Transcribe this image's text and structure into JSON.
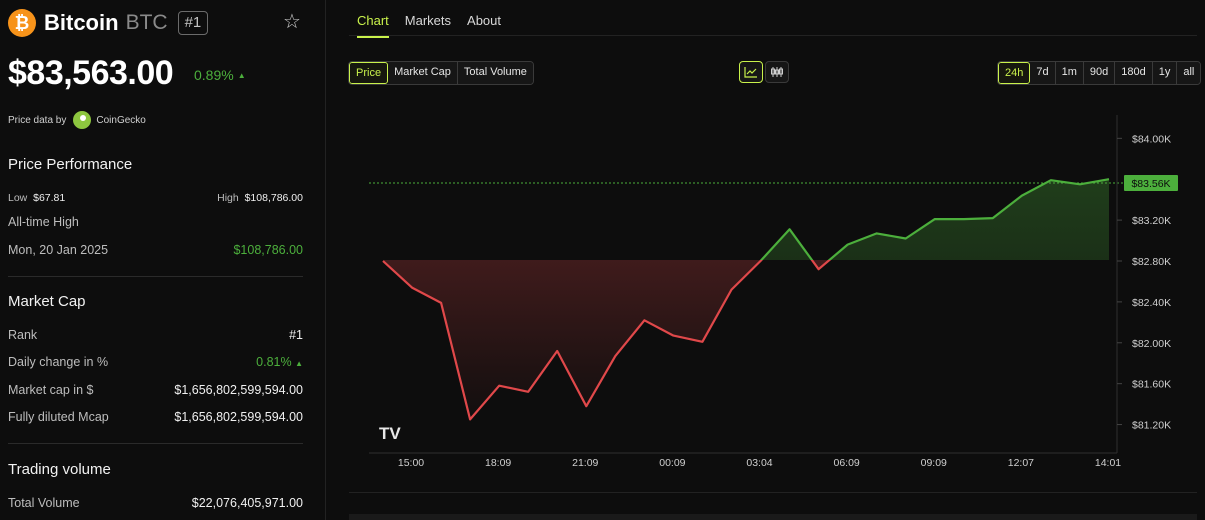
{
  "coin": {
    "logo_glyph": "₿",
    "name": "Bitcoin",
    "symbol": "BTC",
    "rank_badge": "#1",
    "star_icon": "☆"
  },
  "price": {
    "value": "$83,563.00",
    "change": "0.89%",
    "change_dir": "▲"
  },
  "source": {
    "label": "Price data by",
    "name": "CoinGecko"
  },
  "performance": {
    "title": "Price Performance",
    "low_label": "Low",
    "low_value": "$67.81",
    "high_label": "High",
    "high_value": "$108,786.00",
    "ath_label": "All-time High",
    "ath_date": "Mon, 20 Jan 2025",
    "ath_value": "$108,786.00"
  },
  "market_cap": {
    "title": "Market Cap",
    "rank_label": "Rank",
    "rank_value": "#1",
    "daily_label": "Daily change in %",
    "daily_value": "0.81%",
    "daily_dir": "▲",
    "mcap_label": "Market cap in $",
    "mcap_value": "$1,656,802,599,594.00",
    "fd_label": "Fully diluted Mcap",
    "fd_value": "$1,656,802,599,594.00"
  },
  "trading": {
    "title": "Trading volume",
    "total_label": "Total Volume",
    "total_value": "$22,076,405,971.00"
  },
  "tabs": [
    {
      "label": "Chart"
    },
    {
      "label": "Markets"
    },
    {
      "label": "About"
    }
  ],
  "metrics": [
    {
      "label": "Price"
    },
    {
      "label": "Market Cap"
    },
    {
      "label": "Total Volume"
    }
  ],
  "chart_types": [
    {
      "icon": "line-chart-icon",
      "glyph": "📈︎"
    },
    {
      "icon": "candlestick-icon",
      "glyph": "⫼"
    }
  ],
  "ranges": [
    {
      "label": "24h"
    },
    {
      "label": "7d"
    },
    {
      "label": "1m"
    },
    {
      "label": "90d"
    },
    {
      "label": "180d"
    },
    {
      "label": "1y"
    },
    {
      "label": "all"
    }
  ],
  "colors": {
    "accent": "#c9f24b",
    "up": "#4caf3c",
    "down": "#e0484a"
  },
  "chart_data": {
    "type": "line",
    "title": "",
    "xlabel": "",
    "ylabel": "",
    "x_ticks": [
      "15:00",
      "18:09",
      "21:09",
      "00:09",
      "03:04",
      "06:09",
      "09:09",
      "12:07",
      "14:01"
    ],
    "y_ticks": [
      "$84.00K",
      "$83.20K",
      "$82.80K",
      "$82.40K",
      "$82.00K",
      "$81.60K",
      "$81.20K"
    ],
    "ylim": [
      81000,
      84150
    ],
    "baseline": 82810,
    "current_label": "$83.56K",
    "current_value": 83563,
    "values": [
      82800,
      82540,
      82390,
      81250,
      81580,
      81520,
      81920,
      81380,
      81870,
      82220,
      82070,
      82010,
      82520,
      82800,
      83110,
      82720,
      82960,
      83070,
      83020,
      83210,
      83210,
      83220,
      83440,
      83590,
      83550,
      83600
    ],
    "watermark": "TV",
    "grid": false
  }
}
